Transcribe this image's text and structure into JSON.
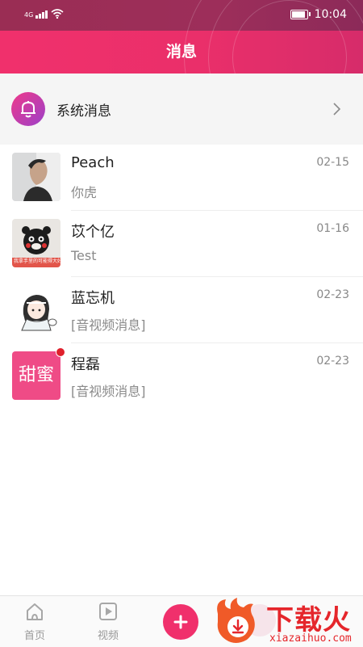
{
  "status_bar": {
    "signal_label": "4G",
    "time": "10:04"
  },
  "header": {
    "title": "消息"
  },
  "system_row": {
    "label": "系统消息"
  },
  "conversations": [
    {
      "name": "Peach",
      "preview": "你虎",
      "date": "02-15",
      "avatar": "photo-man-avatar",
      "unread": false
    },
    {
      "name": "苡个亿",
      "preview": "Test",
      "date": "01-16",
      "avatar": "kumamon-avatar",
      "unread": false,
      "avatar_caption": "我拿手里的可能得大好"
    },
    {
      "name": "蓝忘机",
      "preview": "[音视频消息]",
      "date": "02-23",
      "avatar": "anime-character-avatar",
      "unread": false
    },
    {
      "name": "程磊",
      "preview": "[音视频消息]",
      "date": "02-23",
      "avatar": "tianmi-logo-avatar",
      "unread": true,
      "avatar_text": "甜蜜"
    }
  ],
  "tabbar": {
    "tabs": [
      {
        "label": "首页",
        "icon": "home-icon"
      },
      {
        "label": "视频",
        "icon": "video-icon"
      }
    ],
    "fab_icon": "plus-icon"
  },
  "watermark": {
    "main": "下载火",
    "sub": "xiazaihuo.com"
  },
  "colors": {
    "accent": "#f0306c",
    "status_bar": "#9a2d54",
    "unread_dot": "#e0202c",
    "watermark": "#e5262b"
  }
}
